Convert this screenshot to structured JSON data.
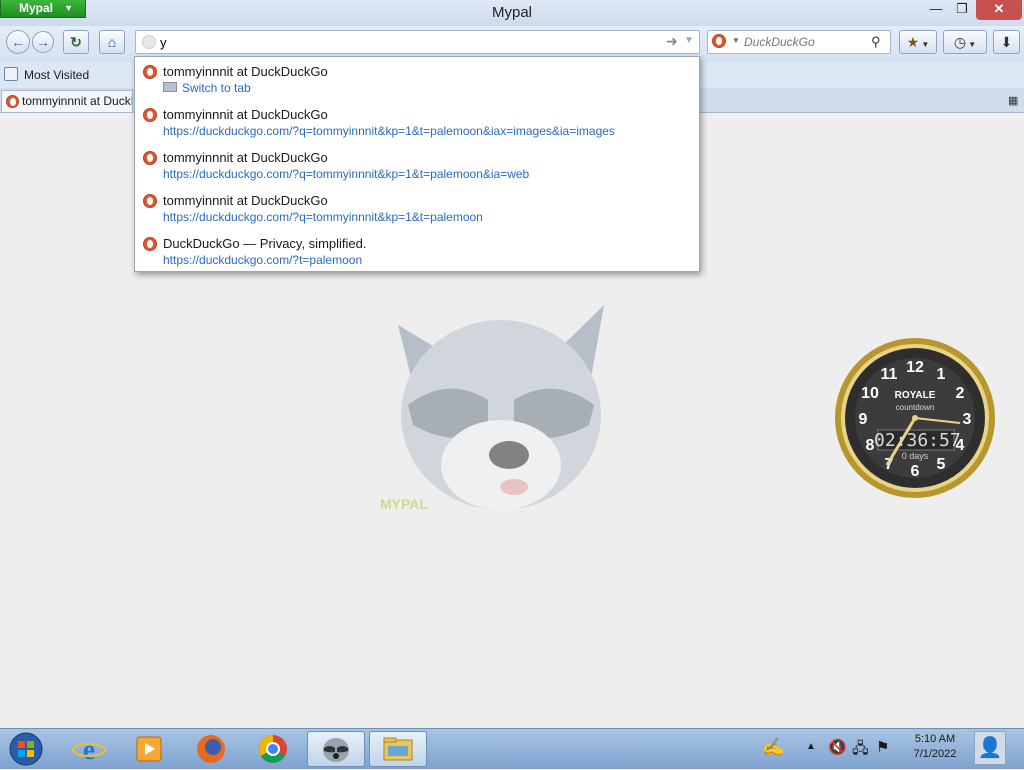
{
  "window": {
    "app_button_label": "Mypal",
    "title": "Mypal",
    "minimize_glyph": "—",
    "maximize_glyph": "❐",
    "close_glyph": "✕"
  },
  "toolbar": {
    "back_icon": "back-arrow-icon",
    "forward_icon": "forward-arrow-icon",
    "reload_icon": "reload-icon",
    "home_icon": "home-icon",
    "bookmarks_icon": "bookmark-star-icon",
    "history_icon": "clock-icon",
    "downloads_icon": "download-arrow-icon"
  },
  "url_bar": {
    "value": "y"
  },
  "search_bar": {
    "placeholder": "DuckDuckGo"
  },
  "bookmarks_bar": {
    "most_visited_label": "Most Visited"
  },
  "tabs": [
    {
      "label": "tommyinnnit at DuckDuckGo"
    }
  ],
  "autocomplete": [
    {
      "title": "tommyinnnit at DuckDuckGo",
      "subtitle": "Switch to tab",
      "type": "switch-to-tab"
    },
    {
      "title": "tommyinnnit at DuckDuckGo",
      "subtitle": "https://duckduckgo.com/?q=tommyinnnit&kp=1&t=palemoon&iax=images&ia=images",
      "type": "url"
    },
    {
      "title": "tommyinnnit at DuckDuckGo",
      "subtitle": "https://duckduckgo.com/?q=tommyinnnit&kp=1&t=palemoon&ia=web",
      "type": "url"
    },
    {
      "title": "tommyinnnit at DuckDuckGo",
      "subtitle": "https://duckduckgo.com/?q=tommyinnnit&kp=1&t=palemoon",
      "type": "url"
    },
    {
      "title": "DuckDuckGo — Privacy, simplified.",
      "subtitle": "https://duckduckgo.com/?t=palemoon",
      "type": "url"
    }
  ],
  "content": {
    "mascot_text": "MYPAL"
  },
  "clock_gadget": {
    "brand": "ROYALE",
    "subtitle": "countdown",
    "time": "02:36:57",
    "days": "0 days",
    "numerals": [
      "12",
      "1",
      "2",
      "3",
      "4",
      "5",
      "6",
      "7",
      "8",
      "9",
      "10",
      "11"
    ]
  },
  "taskbar": {
    "apps": [
      "start-orb",
      "internet-explorer",
      "media-player",
      "firefox",
      "chrome",
      "mypal",
      "file-explorer"
    ],
    "time": "5:10 AM",
    "date": "7/1/2022"
  },
  "colors": {
    "accent_green": "#1e8f1e",
    "close_red": "#c75050",
    "link_blue": "#2a6ac0",
    "ddg_orange": "#de5833"
  }
}
